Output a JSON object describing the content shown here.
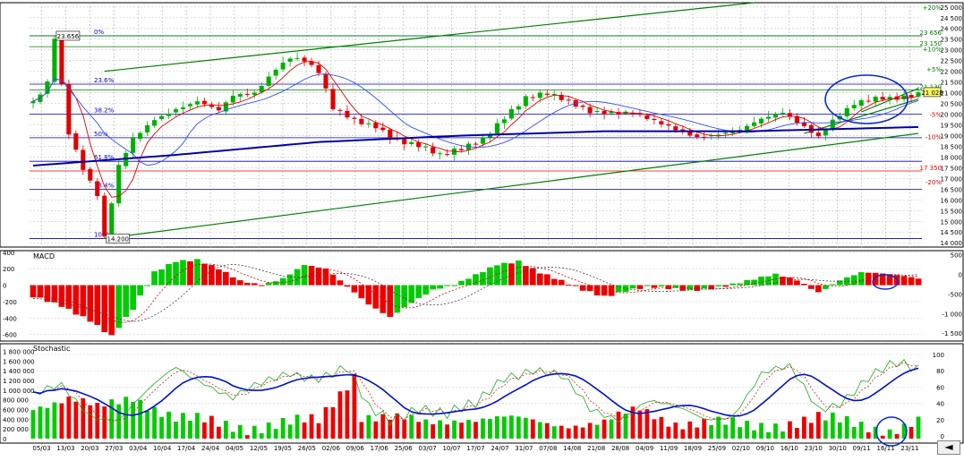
{
  "chart_data": [
    {
      "type": "candlestick",
      "panel": "price",
      "x_ticks": [
        "05/03",
        "13/03",
        "20/03",
        "27/03",
        "03/04",
        "10/04",
        "17/04",
        "24/04",
        "04/05",
        "12/05",
        "19/05",
        "26/05",
        "02/06",
        "09/06",
        "17/06",
        "25/06",
        "03/07",
        "10/07",
        "17/07",
        "24/07",
        "31/07",
        "07/08",
        "14/08",
        "21/08",
        "28/08",
        "04/09",
        "11/09",
        "18/09",
        "25/09",
        "02/10",
        "09/10",
        "16/10",
        "23/10",
        "30/10",
        "09/11",
        "16/11",
        "23/11"
      ],
      "y_ticks": [
        14000,
        14500,
        15000,
        15500,
        16000,
        16500,
        17000,
        17500,
        18000,
        18500,
        19000,
        19500,
        20000,
        20500,
        21000,
        21500,
        22000,
        22500,
        23000,
        23500,
        24000,
        24500,
        25000
      ],
      "ylim": [
        13800,
        25200
      ],
      "close_anchors": [
        {
          "x": 0,
          "v": 20500
        },
        {
          "x": 1,
          "v": 21000
        },
        {
          "x": 2,
          "v": 21500
        },
        {
          "x": 3,
          "v": 23656
        },
        {
          "x": 5,
          "v": 19200
        },
        {
          "x": 7,
          "v": 17500
        },
        {
          "x": 9,
          "v": 16200
        },
        {
          "x": 10,
          "v": 14200
        },
        {
          "x": 11,
          "v": 15800
        },
        {
          "x": 12,
          "v": 17500
        },
        {
          "x": 14,
          "v": 18800
        },
        {
          "x": 17,
          "v": 19800
        },
        {
          "x": 20,
          "v": 20300
        },
        {
          "x": 23,
          "v": 20600
        },
        {
          "x": 26,
          "v": 20100
        },
        {
          "x": 28,
          "v": 20800
        },
        {
          "x": 31,
          "v": 21000
        },
        {
          "x": 34,
          "v": 22200
        },
        {
          "x": 36,
          "v": 22700
        },
        {
          "x": 38,
          "v": 22500
        },
        {
          "x": 40,
          "v": 21900
        },
        {
          "x": 42,
          "v": 20200
        },
        {
          "x": 45,
          "v": 19700
        },
        {
          "x": 48,
          "v": 19500
        },
        {
          "x": 51,
          "v": 18800
        },
        {
          "x": 54,
          "v": 18500
        },
        {
          "x": 57,
          "v": 18000
        },
        {
          "x": 60,
          "v": 18400
        },
        {
          "x": 63,
          "v": 18900
        },
        {
          "x": 66,
          "v": 19900
        },
        {
          "x": 69,
          "v": 20700
        },
        {
          "x": 72,
          "v": 20900
        },
        {
          "x": 75,
          "v": 20600
        },
        {
          "x": 78,
          "v": 20200
        },
        {
          "x": 81,
          "v": 20100
        },
        {
          "x": 84,
          "v": 20000
        },
        {
          "x": 87,
          "v": 19600
        },
        {
          "x": 90,
          "v": 19300
        },
        {
          "x": 93,
          "v": 19000
        },
        {
          "x": 96,
          "v": 19100
        },
        {
          "x": 99,
          "v": 19200
        },
        {
          "x": 102,
          "v": 19700
        },
        {
          "x": 105,
          "v": 20100
        },
        {
          "x": 108,
          "v": 19500
        },
        {
          "x": 110,
          "v": 19000
        },
        {
          "x": 112,
          "v": 19700
        },
        {
          "x": 115,
          "v": 20400
        },
        {
          "x": 118,
          "v": 20700
        },
        {
          "x": 121,
          "v": 20800
        },
        {
          "x": 124,
          "v": 21028
        }
      ],
      "bar_count": 125,
      "moving_average_long": [
        {
          "x": 0,
          "v": 17600
        },
        {
          "x": 20,
          "v": 18100
        },
        {
          "x": 40,
          "v": 18700
        },
        {
          "x": 60,
          "v": 19000
        },
        {
          "x": 80,
          "v": 19200
        },
        {
          "x": 100,
          "v": 19200
        },
        {
          "x": 124,
          "v": 19400
        }
      ],
      "fibonacci_levels": [
        {
          "label": "0%",
          "v": 23656
        },
        {
          "label": "23.6%",
          "v": 21400
        },
        {
          "label": "38.2%",
          "v": 20000
        },
        {
          "label": "50%",
          "v": 18900
        },
        {
          "label": "61.8%",
          "v": 17800
        },
        {
          "label": "78.4%",
          "v": 16500
        },
        {
          "label": "100%",
          "v": 14200
        }
      ],
      "horizontal_lines": [
        {
          "label": "23 656",
          "v": 23656,
          "color": "#008000"
        },
        {
          "label": "23 150",
          "v": 23150,
          "color": "#008000"
        },
        {
          "label": "21 130",
          "v": 21130,
          "color": "#008000"
        },
        {
          "label": "17 350",
          "v": 17350,
          "color": "#ff0000"
        }
      ],
      "percent_labels": [
        {
          "label": "+20%",
          "v": 25000
        },
        {
          "label": "+10%",
          "v": 23050
        },
        {
          "label": "+5%",
          "v": 22100
        },
        {
          "label": "-5%",
          "v": 20000
        },
        {
          "label": "-10%",
          "v": 18950
        },
        {
          "label": "-20%",
          "v": 16850
        }
      ],
      "price_boxes": [
        {
          "label": "23.656",
          "x": 3,
          "v": 23656
        },
        {
          "label": "14.200",
          "x": 10,
          "v": 14200
        },
        {
          "label": "21 028",
          "x": 124,
          "v": 21028
        }
      ],
      "trend_lines": [
        {
          "from": {
            "x": 10,
            "v": 22000
          },
          "to": {
            "x": 101,
            "v": 25200
          }
        },
        {
          "from": {
            "x": 10,
            "v": 14200
          },
          "to": {
            "x": 124,
            "v": 19100
          }
        },
        {
          "from": {
            "x": 116,
            "v": 20100
          },
          "to": {
            "x": 124,
            "v": 21200
          }
        },
        {
          "from": {
            "x": 108,
            "v": 19100
          },
          "to": {
            "x": 124,
            "v": 20700
          }
        }
      ]
    },
    {
      "type": "histogram",
      "panel": "macd",
      "title": "MACD",
      "y_ticks_left": [
        400,
        200,
        0,
        -200,
        -400,
        -600
      ],
      "y_ticks_right": [
        500,
        0,
        -500,
        -1000,
        -1500
      ],
      "ylim": [
        -680,
        420
      ],
      "histogram_anchors": [
        {
          "x": 0,
          "v": -150
        },
        {
          "x": 4,
          "v": -250
        },
        {
          "x": 8,
          "v": -420
        },
        {
          "x": 11,
          "v": -620
        },
        {
          "x": 14,
          "v": -300
        },
        {
          "x": 17,
          "v": 150
        },
        {
          "x": 20,
          "v": 300
        },
        {
          "x": 23,
          "v": 320
        },
        {
          "x": 26,
          "v": 200
        },
        {
          "x": 29,
          "v": 40
        },
        {
          "x": 32,
          "v": -10
        },
        {
          "x": 35,
          "v": 90
        },
        {
          "x": 38,
          "v": 260
        },
        {
          "x": 41,
          "v": 200
        },
        {
          "x": 44,
          "v": -30
        },
        {
          "x": 47,
          "v": -240
        },
        {
          "x": 50,
          "v": -380
        },
        {
          "x": 53,
          "v": -200
        },
        {
          "x": 56,
          "v": -60
        },
        {
          "x": 59,
          "v": -10
        },
        {
          "x": 62,
          "v": 120
        },
        {
          "x": 65,
          "v": 260
        },
        {
          "x": 68,
          "v": 300
        },
        {
          "x": 71,
          "v": 150
        },
        {
          "x": 74,
          "v": 40
        },
        {
          "x": 77,
          "v": -60
        },
        {
          "x": 80,
          "v": -130
        },
        {
          "x": 83,
          "v": -60
        },
        {
          "x": 86,
          "v": -20
        },
        {
          "x": 89,
          "v": -50
        },
        {
          "x": 92,
          "v": -70
        },
        {
          "x": 95,
          "v": -30
        },
        {
          "x": 98,
          "v": 20
        },
        {
          "x": 101,
          "v": 70
        },
        {
          "x": 104,
          "v": 120
        },
        {
          "x": 107,
          "v": 60
        },
        {
          "x": 110,
          "v": -80
        },
        {
          "x": 113,
          "v": 70
        },
        {
          "x": 116,
          "v": 150
        },
        {
          "x": 119,
          "v": 130
        },
        {
          "x": 122,
          "v": 110
        },
        {
          "x": 124,
          "v": 90
        }
      ]
    },
    {
      "type": "bar+line",
      "panel": "stochastic",
      "title": "Stochastic",
      "y_ticks_left": [
        0,
        200000,
        400000,
        600000,
        800000,
        1000000,
        1200000,
        1400000,
        1600000,
        1800000
      ],
      "y_tick_labels_left": [
        "0",
        "200 000",
        "400 000",
        "600 000",
        "800 000",
        "1 000 000",
        "1 200 000",
        "1 400 000",
        "1 600 000",
        "1 800 000"
      ],
      "y_ticks_right": [
        0,
        20,
        40,
        60,
        80,
        100
      ],
      "volume_max": 1900000,
      "volume_anchors": [
        {
          "x": 0,
          "v": 700000
        },
        {
          "x": 5,
          "v": 800000
        },
        {
          "x": 9,
          "v": 600000
        },
        {
          "x": 14,
          "v": 900000
        },
        {
          "x": 20,
          "v": 400000
        },
        {
          "x": 30,
          "v": 250000
        },
        {
          "x": 40,
          "v": 350000
        },
        {
          "x": 45,
          "v": 1350000
        },
        {
          "x": 46,
          "v": 500000
        },
        {
          "x": 55,
          "v": 300000
        },
        {
          "x": 60,
          "v": 450000
        },
        {
          "x": 70,
          "v": 350000
        },
        {
          "x": 80,
          "v": 300000
        },
        {
          "x": 85,
          "v": 600000
        },
        {
          "x": 90,
          "v": 350000
        },
        {
          "x": 100,
          "v": 250000
        },
        {
          "x": 110,
          "v": 400000
        },
        {
          "x": 120,
          "v": 200000
        },
        {
          "x": 124,
          "v": 350000
        }
      ],
      "stoch_anchors": [
        {
          "x": 0,
          "v": 45
        },
        {
          "x": 4,
          "v": 60
        },
        {
          "x": 8,
          "v": 30
        },
        {
          "x": 12,
          "v": 20
        },
        {
          "x": 16,
          "v": 50
        },
        {
          "x": 20,
          "v": 85
        },
        {
          "x": 24,
          "v": 70
        },
        {
          "x": 28,
          "v": 45
        },
        {
          "x": 32,
          "v": 60
        },
        {
          "x": 36,
          "v": 80
        },
        {
          "x": 40,
          "v": 75
        },
        {
          "x": 44,
          "v": 80
        },
        {
          "x": 47,
          "v": 30
        },
        {
          "x": 50,
          "v": 20
        },
        {
          "x": 54,
          "v": 40
        },
        {
          "x": 58,
          "v": 25
        },
        {
          "x": 62,
          "v": 35
        },
        {
          "x": 66,
          "v": 75
        },
        {
          "x": 70,
          "v": 85
        },
        {
          "x": 74,
          "v": 70
        },
        {
          "x": 78,
          "v": 30
        },
        {
          "x": 82,
          "v": 25
        },
        {
          "x": 86,
          "v": 45
        },
        {
          "x": 90,
          "v": 30
        },
        {
          "x": 94,
          "v": 20
        },
        {
          "x": 98,
          "v": 30
        },
        {
          "x": 102,
          "v": 75
        },
        {
          "x": 106,
          "v": 80
        },
        {
          "x": 110,
          "v": 35
        },
        {
          "x": 113,
          "v": 45
        },
        {
          "x": 117,
          "v": 70
        },
        {
          "x": 121,
          "v": 85
        },
        {
          "x": 124,
          "v": 82
        }
      ]
    }
  ],
  "nav": {
    "arrow_label": "◄"
  }
}
